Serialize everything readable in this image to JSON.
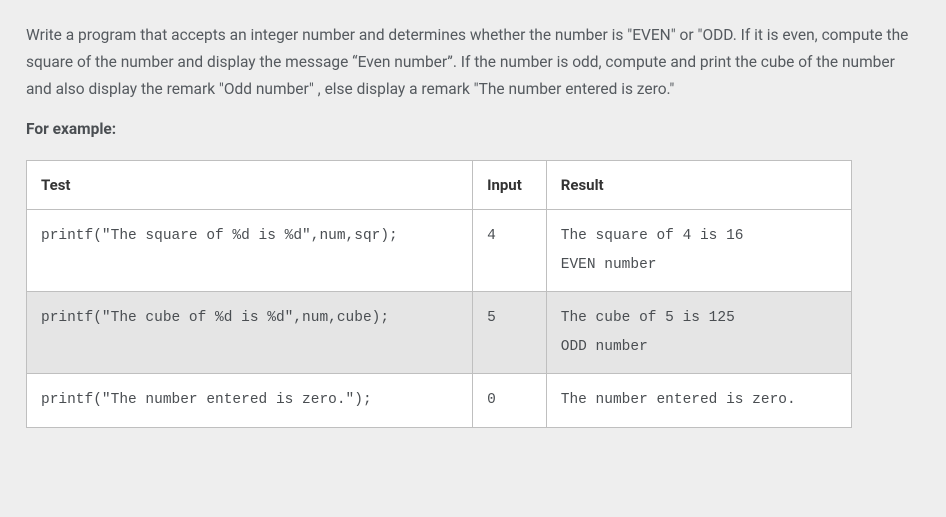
{
  "description": "Write a program that accepts an integer number and determines whether the number is \"EVEN\" or \"ODD. If it is even, compute the square of the number and display the message “Even number”.  If the number is odd, compute and print the cube of the number and also display the remark \"Odd number\" , else display a  remark \"The number entered is zero.\"",
  "example_label": "For example:",
  "table": {
    "headers": [
      "Test",
      "Input",
      "Result"
    ],
    "rows": [
      {
        "test": "printf(\"The square of %d is %d\",num,sqr);",
        "input": "4",
        "result": "The square of 4 is 16\nEVEN number"
      },
      {
        "test": "printf(\"The cube of %d is %d\",num,cube);",
        "input": "5",
        "result": "The cube of 5 is 125\nODD number"
      },
      {
        "test": "printf(\"The number entered is zero.\");",
        "input": "0",
        "result": "The number entered is zero."
      }
    ]
  }
}
